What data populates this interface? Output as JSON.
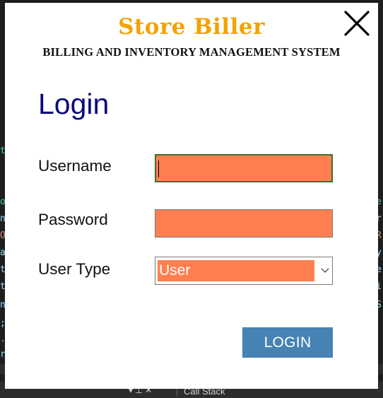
{
  "app": {
    "brand": "Store Biller",
    "subtitle": "BILLING AND INVENTORY MANAGEMENT SYSTEM"
  },
  "form": {
    "heading": "Login",
    "username": {
      "label": "Username",
      "value": ""
    },
    "password": {
      "label": "Password",
      "value": ""
    },
    "user_type": {
      "label": "User Type",
      "selected": "User"
    },
    "submit_label": "LOGIN"
  },
  "background": {
    "panel_tab_label": "Call Stack"
  },
  "colors": {
    "brand": "#f5a200",
    "heading": "#0a0a7a",
    "input_fill": "#ff7f50",
    "button": "#4682b4"
  },
  "icons": {
    "close": "close-icon",
    "dropdown": "chevron-down-icon"
  }
}
